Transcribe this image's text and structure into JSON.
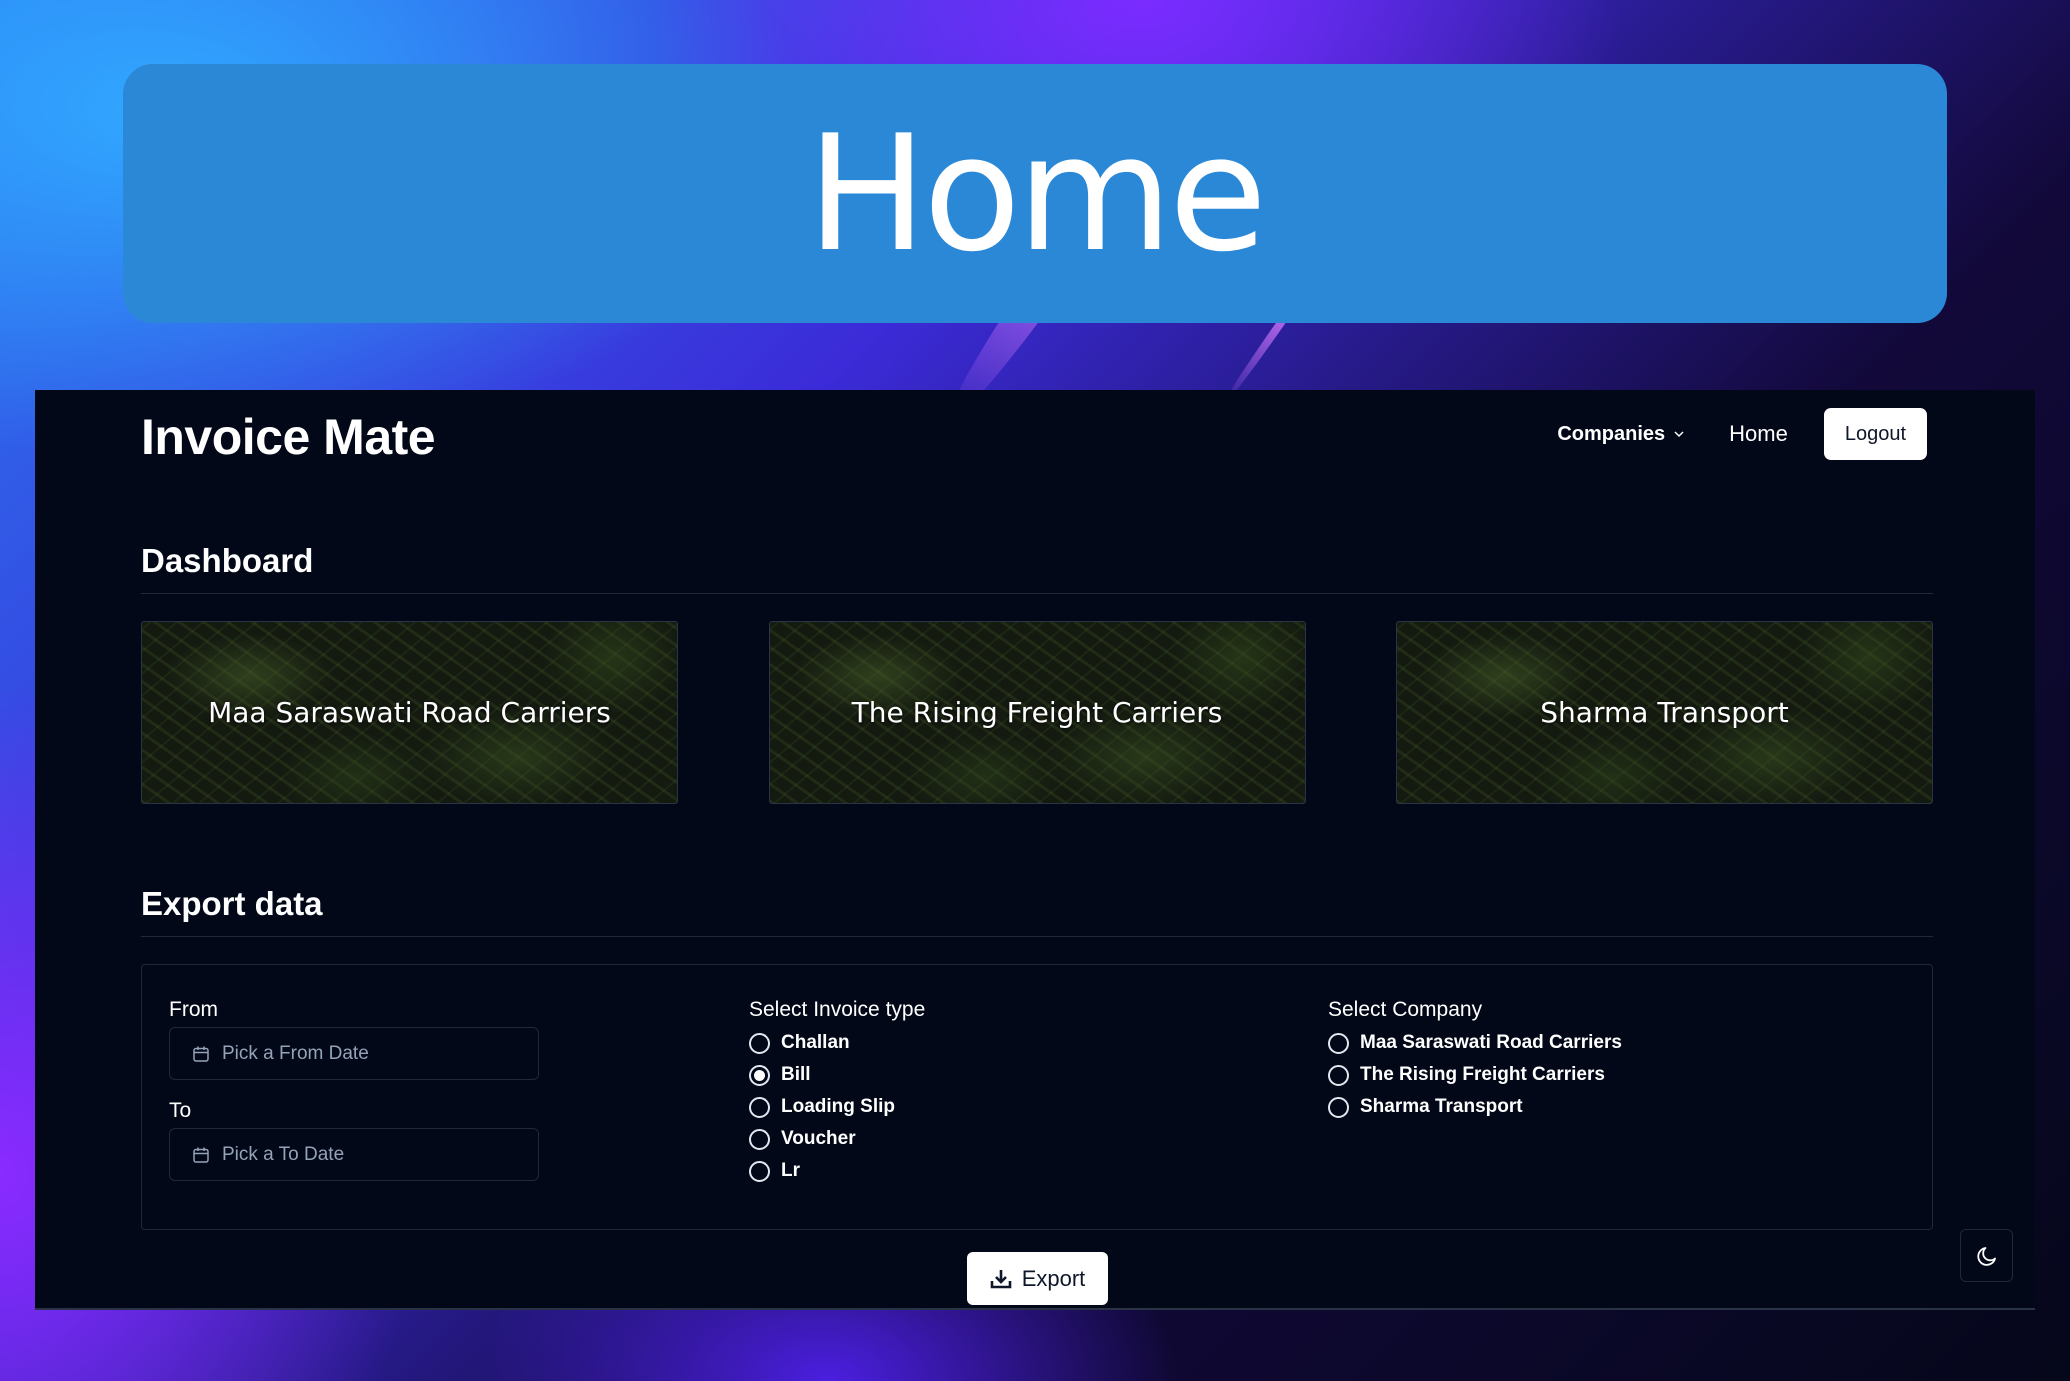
{
  "hero": {
    "title": "Home"
  },
  "header": {
    "brand": "Invoice Mate",
    "nav": {
      "companies_label": "Companies",
      "home_label": "Home",
      "logout_label": "Logout"
    }
  },
  "dashboard": {
    "title": "Dashboard",
    "cards": [
      {
        "label": "Maa Saraswati Road Carriers"
      },
      {
        "label": "The Rising Freight Carriers"
      },
      {
        "label": "Sharma Transport"
      }
    ]
  },
  "export": {
    "title": "Export data",
    "from": {
      "label": "From",
      "placeholder": "Pick a From Date"
    },
    "to": {
      "label": "To",
      "placeholder": "Pick a To Date"
    },
    "invoice_type": {
      "label": "Select Invoice type",
      "selected": "Bill",
      "options": [
        "Challan",
        "Bill",
        "Loading Slip",
        "Voucher",
        "Lr"
      ]
    },
    "company": {
      "label": "Select Company",
      "options": [
        "Maa Saraswati Road Carriers",
        "The Rising Freight Carriers",
        "Sharma Transport"
      ]
    },
    "button_label": "Export"
  },
  "icons": {
    "calendar": "calendar-icon",
    "download": "download-icon",
    "chevron": "chevron-down-icon",
    "theme": "moon-icon"
  },
  "colors": {
    "hero_bg": "#2b88d6",
    "app_bg": "#020817",
    "button_bg": "#ffffff",
    "muted_text": "#94a3b8"
  }
}
